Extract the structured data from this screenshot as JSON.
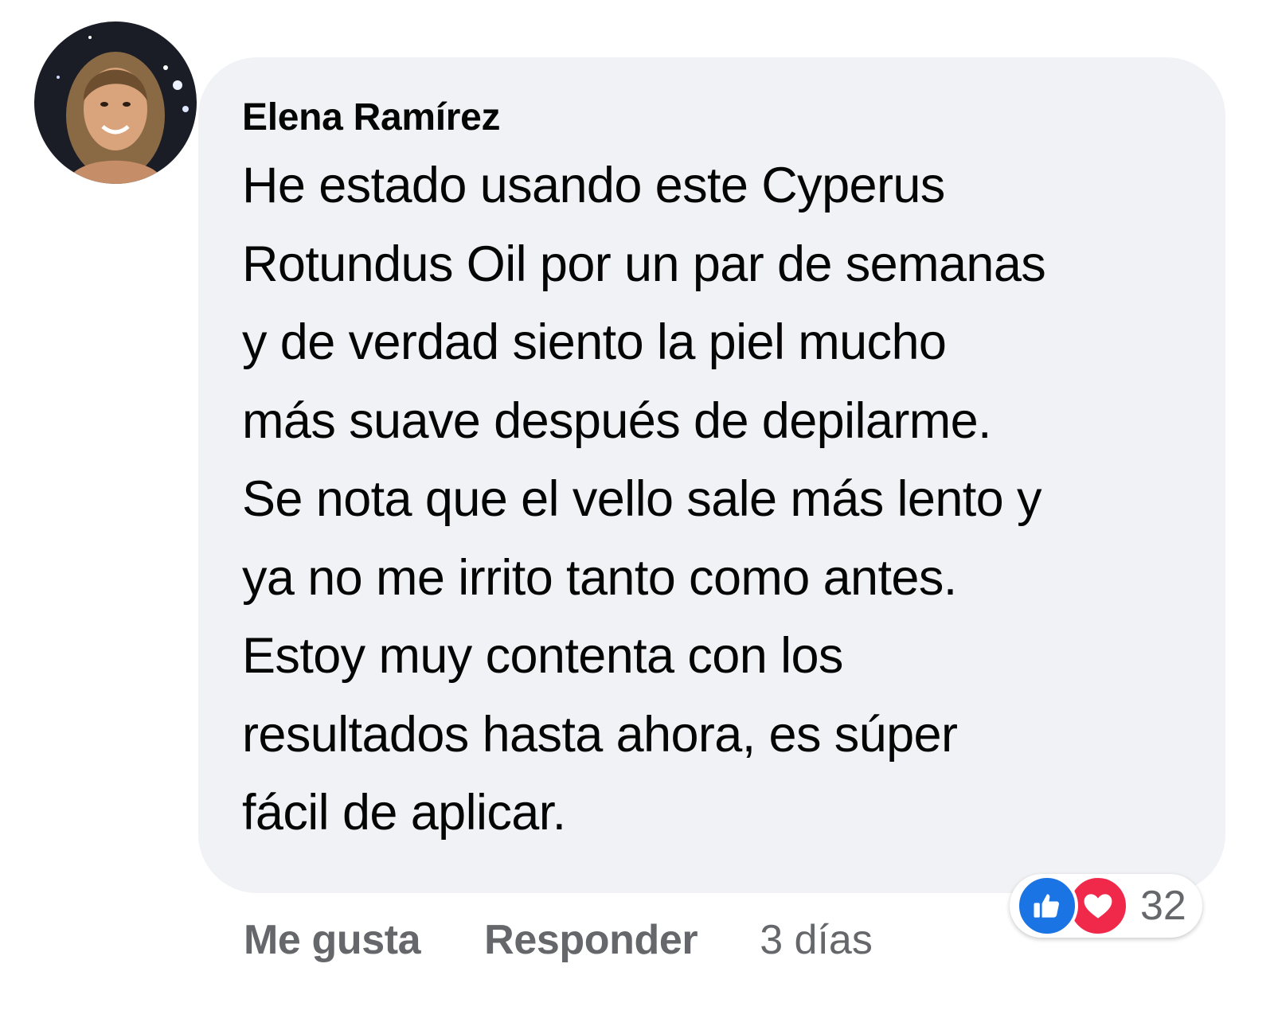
{
  "comment": {
    "author": "Elena Ramírez",
    "text_lines": [
      "He estado usando este Cyperus",
      "Rotundus Oil por un par de semanas",
      "y de verdad siento la piel mucho",
      "más suave después de depilarme.",
      "Se nota que el vello sale más lento y",
      "ya no me irrito tanto como antes.",
      "Estoy muy contenta con los",
      "resultados hasta ahora, es súper",
      "fácil de aplicar."
    ]
  },
  "actions": {
    "like_label": "Me gusta",
    "reply_label": "Responder",
    "timestamp": "3 días"
  },
  "reactions": {
    "icons": [
      "like-icon",
      "love-icon"
    ],
    "count": "32"
  },
  "colors": {
    "bubble": "#f0f2f5",
    "text": "#050505",
    "secondary": "#65676b",
    "like": "#1b74e4",
    "love": "#f0284a"
  }
}
